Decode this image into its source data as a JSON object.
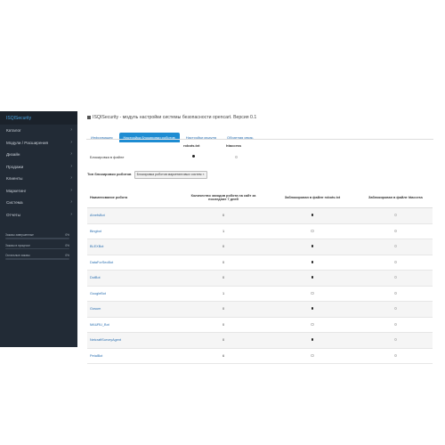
{
  "brand": "ISQISecurity",
  "sidebar": {
    "items": [
      {
        "label": "Каталог"
      },
      {
        "label": "Модули / Расширения"
      },
      {
        "label": "Дизайн"
      },
      {
        "label": "Продажи"
      },
      {
        "label": "Клиенты"
      },
      {
        "label": "Маркетинг"
      },
      {
        "label": "Система"
      },
      {
        "label": "Отчеты"
      }
    ],
    "stats": [
      {
        "label": "Заказы завершенные",
        "percent": "0%",
        "value": 0
      },
      {
        "label": "Заказы в процессе",
        "percent": "0%",
        "value": 0
      },
      {
        "label": "Остальные заказы",
        "percent": "0%",
        "value": 0
      }
    ]
  },
  "header": {
    "title": "ISQISecurity - модуль настройки системы безопасности opencart. Версия 0.1"
  },
  "tabs": [
    {
      "label": "Информация",
      "active": false
    },
    {
      "label": "Настройка блокировки роботов",
      "active": true
    },
    {
      "label": "Настройки модуля",
      "active": false
    },
    {
      "label": "Обратная связь",
      "active": false
    }
  ],
  "mini_table": {
    "col1": "robots.txt",
    "col2": "htaccess",
    "row_label": "Блокировка в файле"
  },
  "filter": {
    "label": "Тип блокировки роботов",
    "selected": "Блокировка роботов маркетинговых систем"
  },
  "robots_table": {
    "headers": [
      "Наименование робота",
      "Количество заходов робота на сайт за последние 7 дней",
      "Заблокирован в файле robots.txt",
      "Заблокирован в файле htaccess"
    ],
    "rows": [
      {
        "name": "AhrefsBot",
        "visits": "0",
        "robots": true,
        "htaccess": false
      },
      {
        "name": "Bingbot",
        "visits": "1",
        "robots": false,
        "htaccess": false
      },
      {
        "name": "BLEXBot",
        "visits": "0",
        "robots": true,
        "htaccess": false
      },
      {
        "name": "DataForSeoBot",
        "visits": "0",
        "robots": true,
        "htaccess": false
      },
      {
        "name": "DotBot",
        "visits": "0",
        "robots": true,
        "htaccess": false
      },
      {
        "name": "GoogleBot",
        "visits": "1",
        "robots": false,
        "htaccess": false
      },
      {
        "name": "Gosum",
        "visits": "0",
        "robots": true,
        "htaccess": false
      },
      {
        "name": "MAURU_Bot",
        "visits": "0",
        "robots": false,
        "htaccess": false
      },
      {
        "name": "NetcraftSurveyAgent",
        "visits": "0",
        "robots": true,
        "htaccess": false
      },
      {
        "name": "PetalBot",
        "visits": "6",
        "robots": false,
        "htaccess": false
      }
    ]
  }
}
